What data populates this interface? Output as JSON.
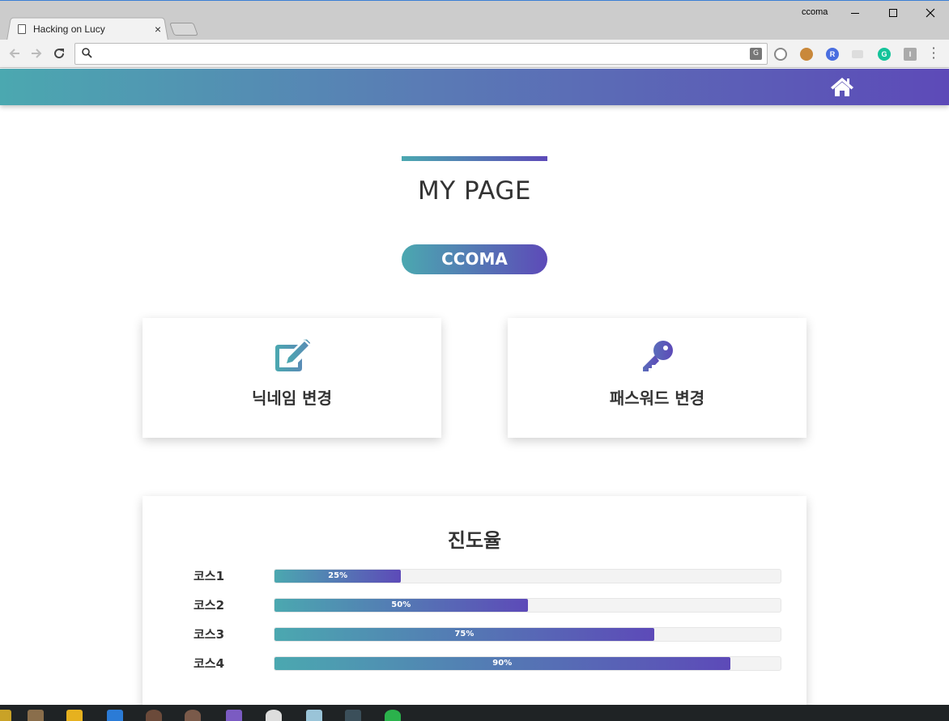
{
  "browser": {
    "tab_title": "Hacking on Lucy",
    "tab_close": "×",
    "profile_name": "ccoma",
    "address_value": "",
    "translate_icon": "translate-icon"
  },
  "navbar": {
    "home_icon": "home-icon"
  },
  "page": {
    "title": "MY PAGE",
    "username": "CCOMA"
  },
  "cards": [
    {
      "label": "닉네임 변경",
      "icon": "edit-icon"
    },
    {
      "label": "패스워드 변경",
      "icon": "key-icon"
    }
  ],
  "progress": {
    "title": "진도율",
    "courses": [
      {
        "label": "코스1",
        "percent": 25,
        "text": "25%"
      },
      {
        "label": "코스2",
        "percent": 50,
        "text": "50%"
      },
      {
        "label": "코스3",
        "percent": 75,
        "text": "75%"
      },
      {
        "label": "코스4",
        "percent": 90,
        "text": "90%"
      }
    ]
  },
  "colors": {
    "gradient_start": "#4ba8b0",
    "gradient_end": "#5d4ab8"
  }
}
